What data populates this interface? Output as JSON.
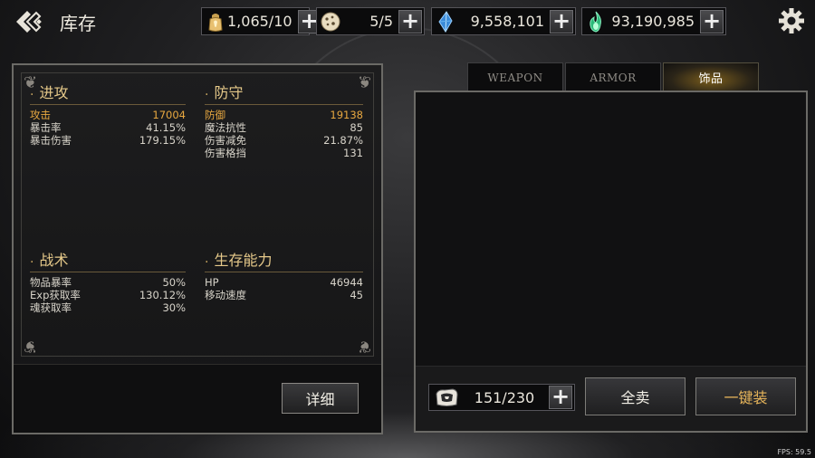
{
  "header": {
    "title": "库存"
  },
  "resources": [
    {
      "icon": "lantern-fuel-icon",
      "value": "1,065/10"
    },
    {
      "icon": "cookie-icon",
      "value": "5/5"
    },
    {
      "icon": "blue-crystal-icon",
      "value": "9,558,101"
    },
    {
      "icon": "green-soul-flame-icon",
      "value": "93,190,985"
    }
  ],
  "stats": {
    "offense": {
      "title": "进攻",
      "rows": [
        {
          "label": "攻击",
          "value": "17004"
        },
        {
          "label": "暴击率",
          "value": "41.15%"
        },
        {
          "label": "暴击伤害",
          "value": "179.15%"
        }
      ]
    },
    "defense": {
      "title": "防守",
      "rows": [
        {
          "label": "防御",
          "value": "19138"
        },
        {
          "label": "魔法抗性",
          "value": "85"
        },
        {
          "label": "伤害减免",
          "value": "21.87%"
        },
        {
          "label": "伤害格挡",
          "value": "131"
        }
      ]
    },
    "tactics": {
      "title": "战术",
      "rows": [
        {
          "label": "物品暴率",
          "value": "50%"
        },
        {
          "label": "Exp获取率",
          "value": "130.12%"
        },
        {
          "label": "魂获取率",
          "value": "30%"
        }
      ]
    },
    "survival": {
      "title": "生存能力",
      "rows": [
        {
          "label": "HP",
          "value": "46944"
        },
        {
          "label": "移动速度",
          "value": "45"
        }
      ]
    },
    "detail_button": "详细"
  },
  "inventory": {
    "tabs": [
      "WEAPON",
      "ARMOR",
      "饰品"
    ],
    "active_tab": "饰品",
    "capacity": "151/230",
    "sell_all_button": "全卖",
    "equip_all_button": "一键装"
  },
  "fps": "FPS: 59.5",
  "colors": {
    "highlight_stat": "#e8a840",
    "group_title": "#e6c98a",
    "equip_button_text": "#e6b45a",
    "sell_button_text": "#f2efe6",
    "active_tab_glow": "#7a5d1c"
  }
}
